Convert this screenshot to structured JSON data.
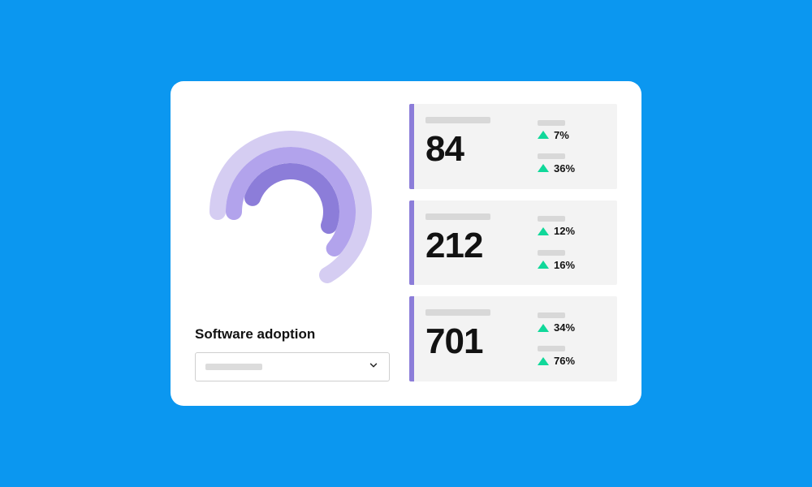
{
  "section_title": "Software adoption",
  "dropdown": {
    "placeholder": ""
  },
  "chart_data": {
    "type": "radial",
    "rings": [
      {
        "color": "#d5cdf2",
        "radius": 90,
        "strokeWidth": 20,
        "startAngle": -90,
        "arcDegrees": 240
      },
      {
        "color": "#b2a3ec",
        "radius": 70,
        "strokeWidth": 20,
        "startAngle": -90,
        "arcDegrees": 220
      },
      {
        "color": "#8c7dd9",
        "radius": 50,
        "strokeWidth": 20,
        "startAngle": -70,
        "arcDegrees": 180
      }
    ]
  },
  "metrics": [
    {
      "value": "84",
      "deltas": [
        {
          "pct": "7%"
        },
        {
          "pct": "36%"
        }
      ]
    },
    {
      "value": "212",
      "deltas": [
        {
          "pct": "12%"
        },
        {
          "pct": "16%"
        }
      ]
    },
    {
      "value": "701",
      "deltas": [
        {
          "pct": "34%"
        },
        {
          "pct": "76%"
        }
      ]
    }
  ]
}
